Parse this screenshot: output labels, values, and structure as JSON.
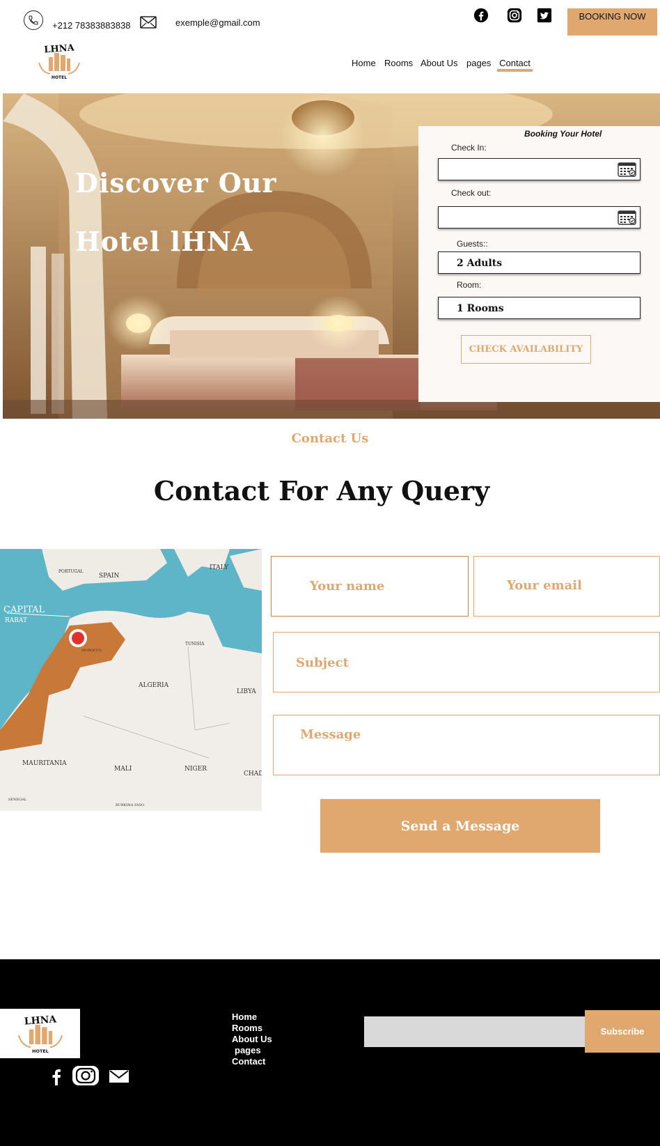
{
  "topbar": {
    "phone": "+212 78383883838",
    "email": "exemple@gmail.com",
    "booking_button": "BOOKING NOW",
    "social_icons": [
      "facebook-icon",
      "instagram-icon",
      "twitter-icon"
    ]
  },
  "brand": {
    "logo_text": "LHNA",
    "logo_subtitle": "HOTEL"
  },
  "nav": {
    "items": [
      "Home",
      "Rooms",
      "About Us",
      "pages",
      "Contact"
    ],
    "active": "Contact"
  },
  "hero": {
    "line1": "Discover Our",
    "line2": "Hotel lHNA"
  },
  "booking": {
    "title": "Booking Your Hotel",
    "check_in_label": "Check In:",
    "check_in_value": "",
    "check_out_label": "Check out:",
    "check_out_value": "",
    "guests_label": "Guests::",
    "guests_value": "2 Adults",
    "room_label": "Room:",
    "room_value": "1 Rooms",
    "check_button": "CHECK AVAILABILITY"
  },
  "contact": {
    "kicker": "Contact Us",
    "title": "Contact For Any Query",
    "name_placeholder": "Your name",
    "email_placeholder": "Your email",
    "subject_placeholder": "Subject",
    "message_placeholder": "Message",
    "send_button": "Send a Message"
  },
  "map": {
    "labels": {
      "capital": "CAPITAL",
      "rabat": "RABAT",
      "spain": "SPAIN",
      "portugal": "PORTUGAL",
      "italy": "ITALY",
      "algeria": "ALGERIA",
      "libya": "LIBYA",
      "tunisia": "TUNISIA",
      "morocco": "MOROCCO",
      "mauritania": "MAURITANIA",
      "mali": "MALI",
      "niger": "NIGER",
      "chad": "CHAD",
      "senegal": "SENEGAL",
      "burkina": "BURKINA FASO"
    }
  },
  "footer": {
    "links": [
      "Home",
      "Rooms",
      "About Us",
      "pages",
      "Contact"
    ],
    "subscribe_button": "Subscribe",
    "subscribe_placeholder": "",
    "social_icons": [
      "facebook-icon",
      "instagram-icon",
      "mail-icon"
    ]
  },
  "colors": {
    "accent": "#e0a86f",
    "footer_bg": "#000000"
  }
}
